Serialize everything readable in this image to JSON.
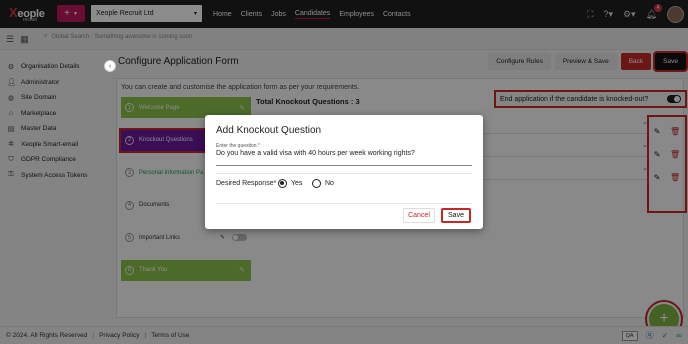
{
  "topbar": {
    "logo_text": "Xeople",
    "logo_sub": "recruit",
    "add_button": "+",
    "company": "Xeople Recruit Ltd",
    "nav": [
      "Home",
      "Clients",
      "Jobs",
      "Candidates",
      "Employees",
      "Contacts"
    ],
    "active_nav": "Candidates",
    "notification_count": "4"
  },
  "searchbar": {
    "placeholder": "Global Search - Something awesome is coming soon"
  },
  "sidebar": {
    "items": [
      {
        "label": "Organisation Details",
        "icon": "gear-icon"
      },
      {
        "label": "Administrator",
        "icon": "user-icon"
      },
      {
        "label": "Site Domain",
        "icon": "globe-icon"
      },
      {
        "label": "Marketplace",
        "icon": "store-icon"
      },
      {
        "label": "Master Data",
        "icon": "database-icon"
      },
      {
        "label": "Xeople Smart-email",
        "icon": "settings-icon"
      },
      {
        "label": "GDPR Compliance",
        "icon": "shield-icon"
      },
      {
        "label": "System Access Tokens",
        "icon": "key-icon"
      }
    ]
  },
  "main": {
    "title": "Configure Application Form",
    "buttons": {
      "configure_rules": "Configure Rules",
      "preview_save": "Preview & Save",
      "back": "Back",
      "save": "Save"
    },
    "intro": "You can create and customise the application form as per your requirements.",
    "steps": [
      {
        "num": "1",
        "label": "Welcome Page"
      },
      {
        "num": "2",
        "label": "Knockout Questions"
      },
      {
        "num": "3",
        "label": "Personal Information Pa"
      },
      {
        "num": "4",
        "label": "Documents"
      },
      {
        "num": "5",
        "label": "Important Links"
      },
      {
        "num": "6",
        "label": "Thank You"
      }
    ],
    "knockout_total": "Total Knockout Questions : 3",
    "end_application_label": "End application if the candidate is knocked-out?"
  },
  "modal": {
    "title": "Add Knockout Question",
    "field_label": "Enter the question.*",
    "field_value": "Do you have a valid visa with 40 hours per week working rights?",
    "desired_response_label": "Desired Response*",
    "options": [
      "Yes",
      "No"
    ],
    "selected": "Yes",
    "cancel": "Cancel",
    "save": "Save"
  },
  "footer": {
    "copyright": "© 2024. All Rights Reserved",
    "privacy": "Privacy Policy",
    "terms": "Terms of Use",
    "badge": "QA"
  },
  "colors": {
    "accent": "#c2185b",
    "highlight": "#c62828",
    "step_green": "#8bc34a",
    "step_active": "#6a1b9a"
  }
}
